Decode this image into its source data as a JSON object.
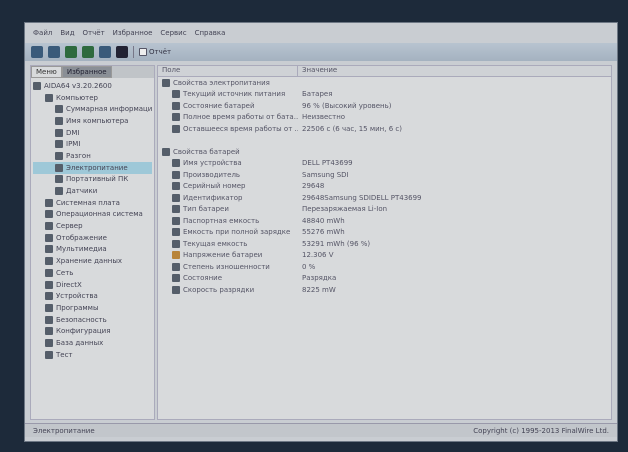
{
  "menu": [
    "Файл",
    "Вид",
    "Отчёт",
    "Избранное",
    "Сервис",
    "Справка"
  ],
  "toolbar": {
    "report_label": "Отчёт"
  },
  "tabs": [
    "Меню",
    "Избранное"
  ],
  "tree": [
    {
      "label": "AIDA64 v3.20.2600",
      "level": 0
    },
    {
      "label": "Компьютер",
      "level": 1
    },
    {
      "label": "Суммарная информация",
      "level": 2
    },
    {
      "label": "Имя компьютера",
      "level": 2
    },
    {
      "label": "DMI",
      "level": 2
    },
    {
      "label": "IPMI",
      "level": 2
    },
    {
      "label": "Разгон",
      "level": 2
    },
    {
      "label": "Электропитание",
      "level": 2,
      "selected": true
    },
    {
      "label": "Портативный ПК",
      "level": 2
    },
    {
      "label": "Датчики",
      "level": 2
    },
    {
      "label": "Системная плата",
      "level": 1
    },
    {
      "label": "Операционная система",
      "level": 1
    },
    {
      "label": "Сервер",
      "level": 1
    },
    {
      "label": "Отображение",
      "level": 1
    },
    {
      "label": "Мультимедиа",
      "level": 1
    },
    {
      "label": "Хранение данных",
      "level": 1
    },
    {
      "label": "Сеть",
      "level": 1
    },
    {
      "label": "DirectX",
      "level": 1
    },
    {
      "label": "Устройства",
      "level": 1
    },
    {
      "label": "Программы",
      "level": 1
    },
    {
      "label": "Безопасность",
      "level": 1
    },
    {
      "label": "Конфигурация",
      "level": 1
    },
    {
      "label": "База данных",
      "level": 1
    },
    {
      "label": "Тест",
      "level": 1
    }
  ],
  "columns": {
    "field": "Поле",
    "value": "Значение"
  },
  "rows": [
    {
      "type": "grp",
      "field": "Свойства электропитания",
      "value": ""
    },
    {
      "type": "item",
      "field": "Текущий источник питания",
      "value": "Батарея"
    },
    {
      "type": "item",
      "field": "Состояние батарей",
      "value": "96 % (Высокий уровень)"
    },
    {
      "type": "item",
      "field": "Полное время работы от бата...",
      "value": "Неизвестно"
    },
    {
      "type": "item",
      "field": "Оставшееся время работы от ...",
      "value": "22506 с (6 час, 15 мин, 6 с)"
    },
    {
      "type": "blank",
      "field": "",
      "value": ""
    },
    {
      "type": "grp",
      "field": "Свойства батарей",
      "value": ""
    },
    {
      "type": "item",
      "field": "Имя устройства",
      "value": "DELL PT43699"
    },
    {
      "type": "item",
      "field": "Производитель",
      "value": "Samsung SDI"
    },
    {
      "type": "item",
      "field": "Серийный номер",
      "value": "29648"
    },
    {
      "type": "item",
      "field": "Идентификатор",
      "value": "29648Samsung SDIDELL PT43699"
    },
    {
      "type": "item",
      "field": "Тип батареи",
      "value": "Перезаряжаемая Li-Ion"
    },
    {
      "type": "item",
      "field": "Паспортная емкость",
      "value": "48840 mWh"
    },
    {
      "type": "item",
      "field": "Емкость при полной зарядке",
      "value": "55276 mWh"
    },
    {
      "type": "item",
      "field": "Текущая емкость",
      "value": "53291 mWh  (96 %)"
    },
    {
      "type": "item",
      "field": "Напряжение батареи",
      "value": "12.306 V",
      "warn": true
    },
    {
      "type": "item",
      "field": "Степень изношенности",
      "value": "0 %"
    },
    {
      "type": "item",
      "field": "Состояние",
      "value": "Разрядка"
    },
    {
      "type": "item",
      "field": "Скорость разрядки",
      "value": "8225 mW"
    }
  ],
  "status": {
    "left": "Электропитание",
    "right": "Copyright (c) 1995-2013 FinalWire Ltd."
  }
}
